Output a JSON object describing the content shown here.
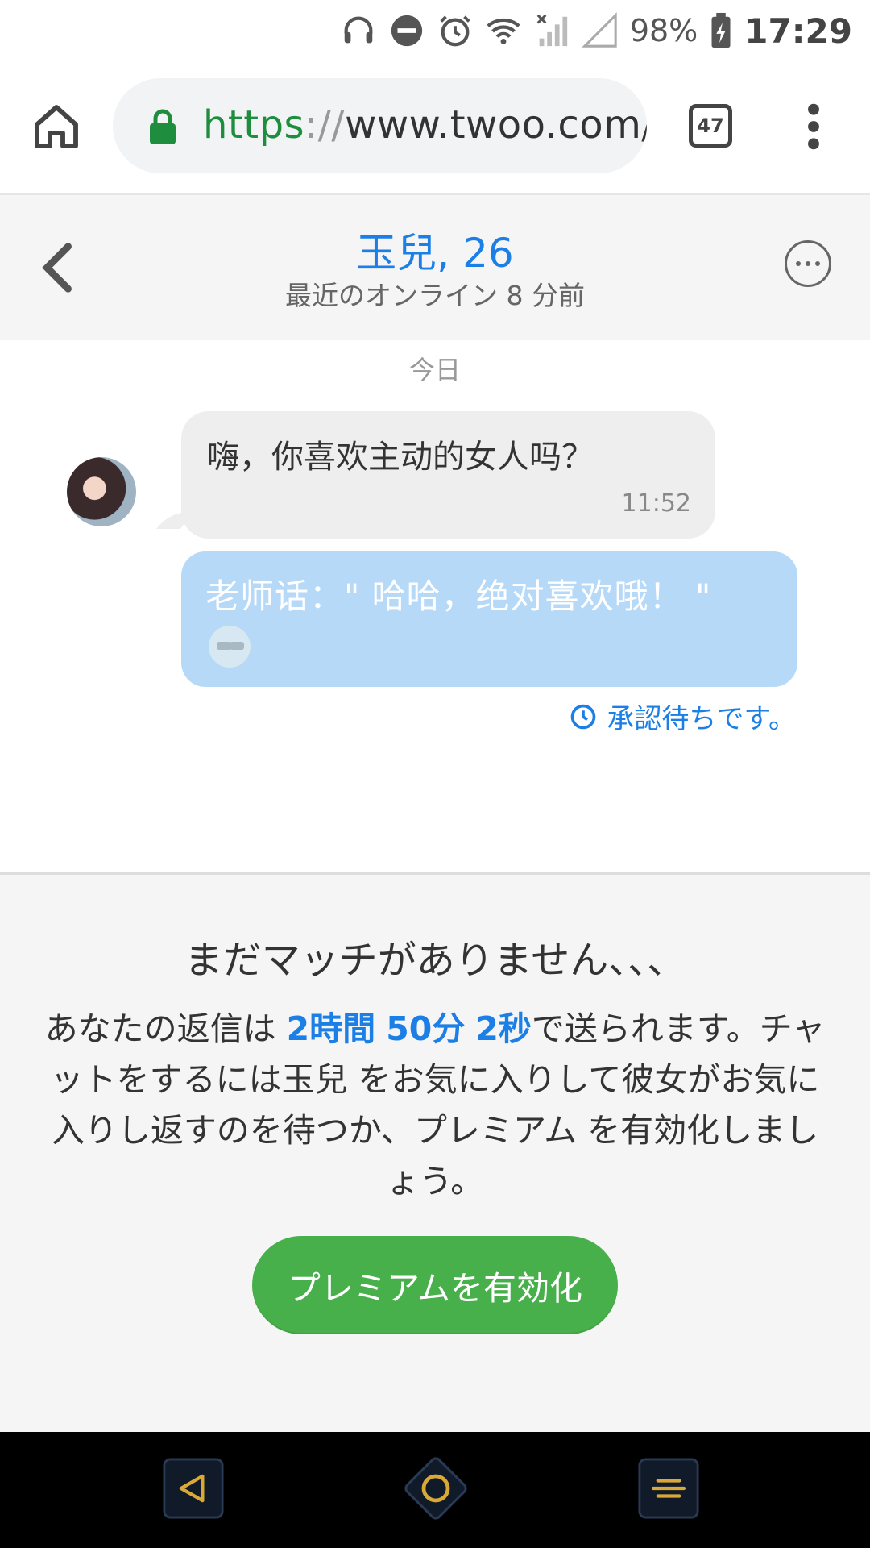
{
  "status_bar": {
    "battery": "98%",
    "time": "17:29"
  },
  "browser": {
    "url_scheme": "https",
    "url_separator": "://",
    "url_rest": "www.twoo.com/r",
    "tab_count": "47"
  },
  "chat_header": {
    "title": "玉兒, 26",
    "subtitle": "最近のオンライン 8 分前"
  },
  "chat": {
    "day_label": "今日",
    "incoming": {
      "text": "嗨，你喜欢主动的女人吗？",
      "time": "11:52"
    },
    "outgoing": {
      "text": "老师话：\" 哈哈，绝对喜欢哦！ \""
    },
    "pending_status": "承認待ちです。"
  },
  "panel": {
    "title": "まだマッチがありません、、、",
    "body_prefix": "あなたの返信は ",
    "countdown_hours": "2時間",
    "countdown_minutes": "50分",
    "countdown_seconds": "2秒",
    "body_suffix": "で送られます。チャットをするには玉兒 をお気に入りして彼女がお気に入りし返すのを待つか、プレミアム を有効化しましょう。",
    "button_label": "プレミアムを有効化"
  },
  "colors": {
    "accent_blue": "#1c7fe6",
    "button_green": "#47b04b",
    "outgoing_bubble": "#b6d9f8",
    "incoming_bubble": "#eeeeee"
  },
  "icons": [
    "headphones-icon",
    "do-not-disturb-icon",
    "alarm-icon",
    "wifi-icon",
    "signal-icon",
    "battery-charging-icon",
    "home-icon",
    "lock-icon",
    "tabs-icon",
    "overflow-menu-icon",
    "back-chevron-icon",
    "more-options-icon",
    "clock-icon",
    "nav-back-icon",
    "nav-home-icon",
    "nav-recents-icon"
  ]
}
